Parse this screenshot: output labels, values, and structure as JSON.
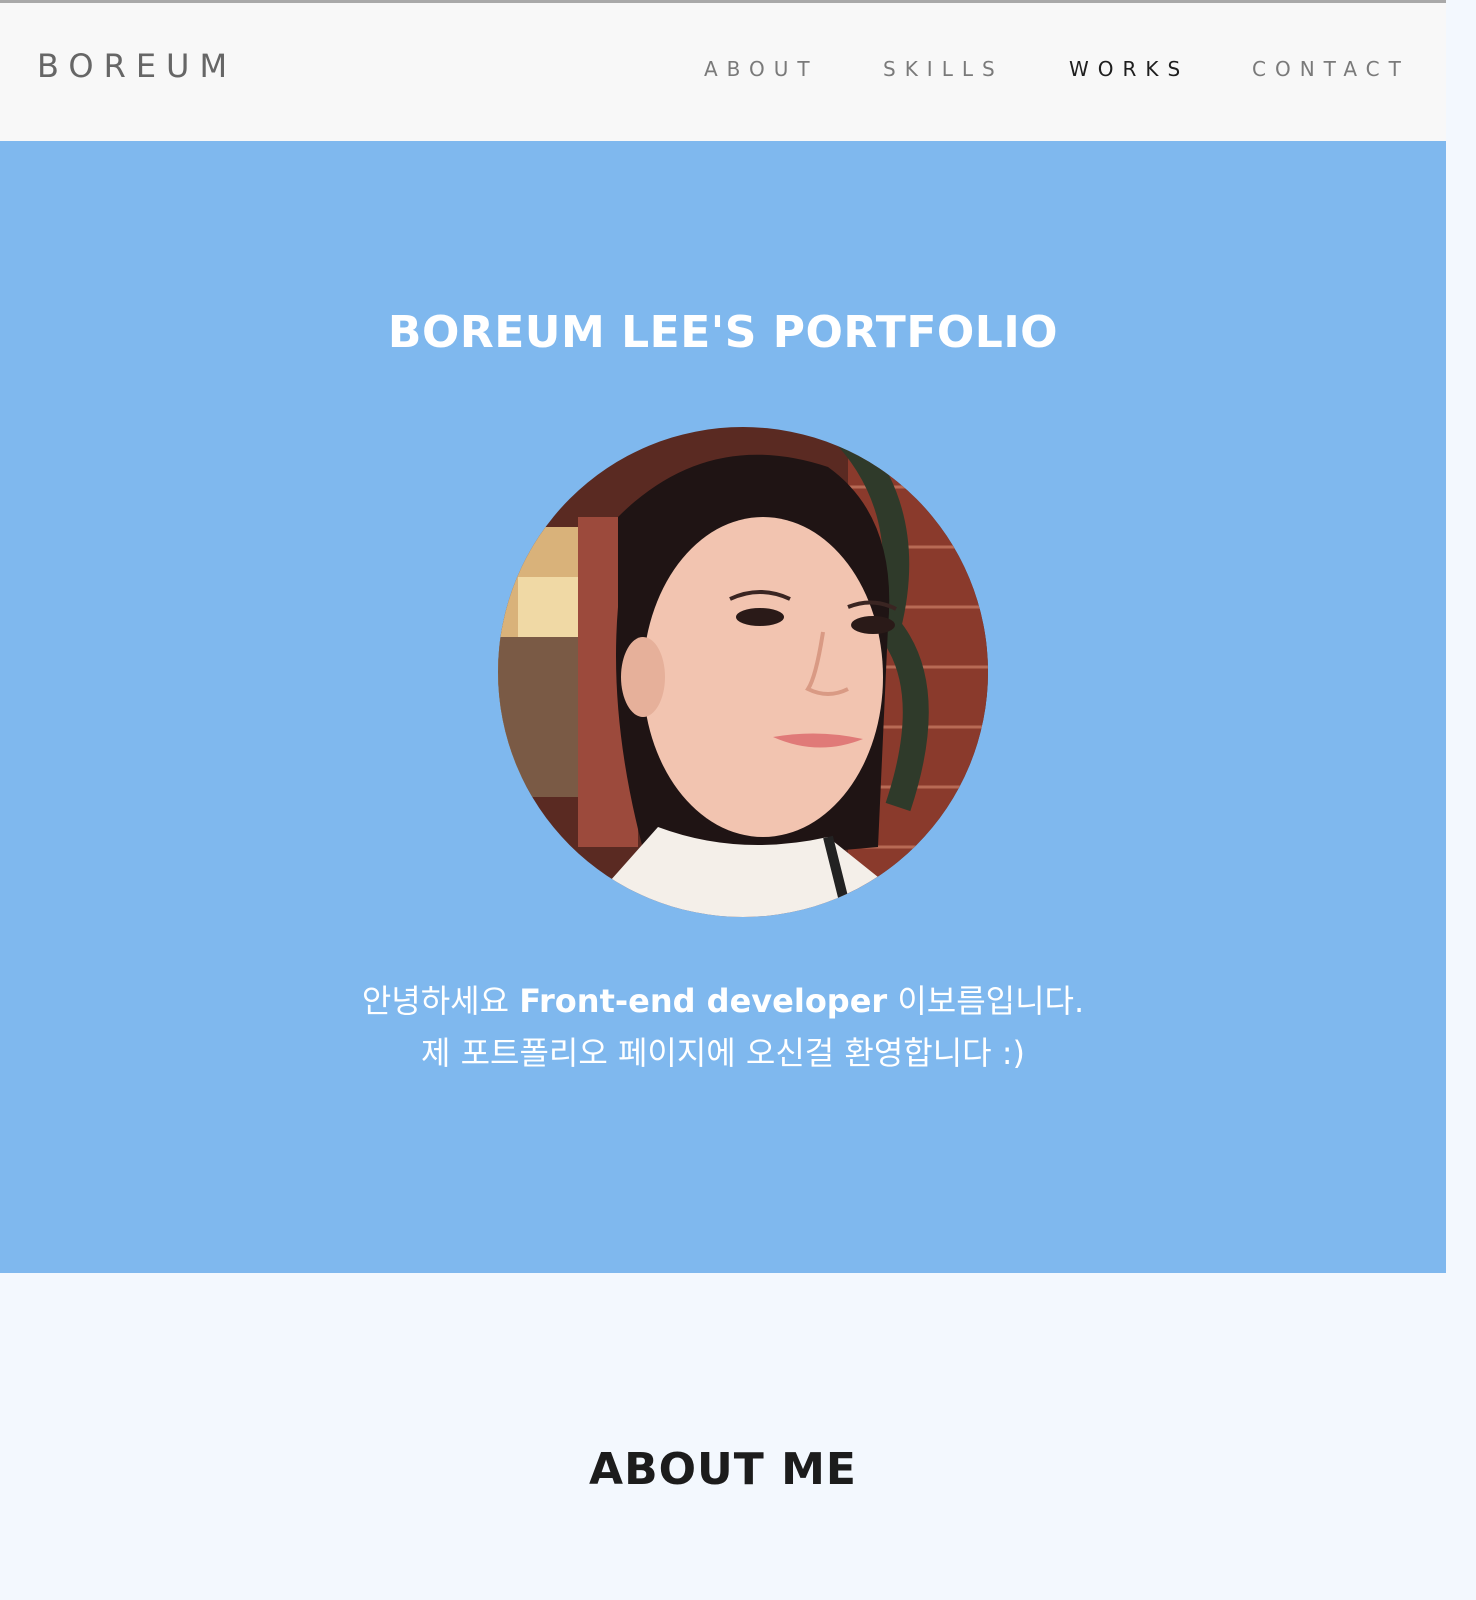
{
  "nav": {
    "brand": "BOREUM",
    "items": [
      {
        "label": "ABOUT",
        "active": false
      },
      {
        "label": "SKILLS",
        "active": false
      },
      {
        "label": "WORKS",
        "active": true
      },
      {
        "label": "CONTACT",
        "active": false
      }
    ]
  },
  "hero": {
    "title": "BOREUM LEE'S PORTFOLIO",
    "greeting_prefix": "안녕하세요 ",
    "greeting_role": "Front-end developer",
    "greeting_suffix": " 이보름입니다.",
    "welcome_line": "제 포트폴리오 페이지에 오신걸 환영합니다 :)"
  },
  "about": {
    "title": "ABOUT ME"
  },
  "colors": {
    "hero_background": "#7fb8ee",
    "nav_background": "#f8f8f8",
    "about_background": "#f3f8fe",
    "active_nav": "#1e1e1e",
    "inactive_nav": "#7a7a7a"
  }
}
